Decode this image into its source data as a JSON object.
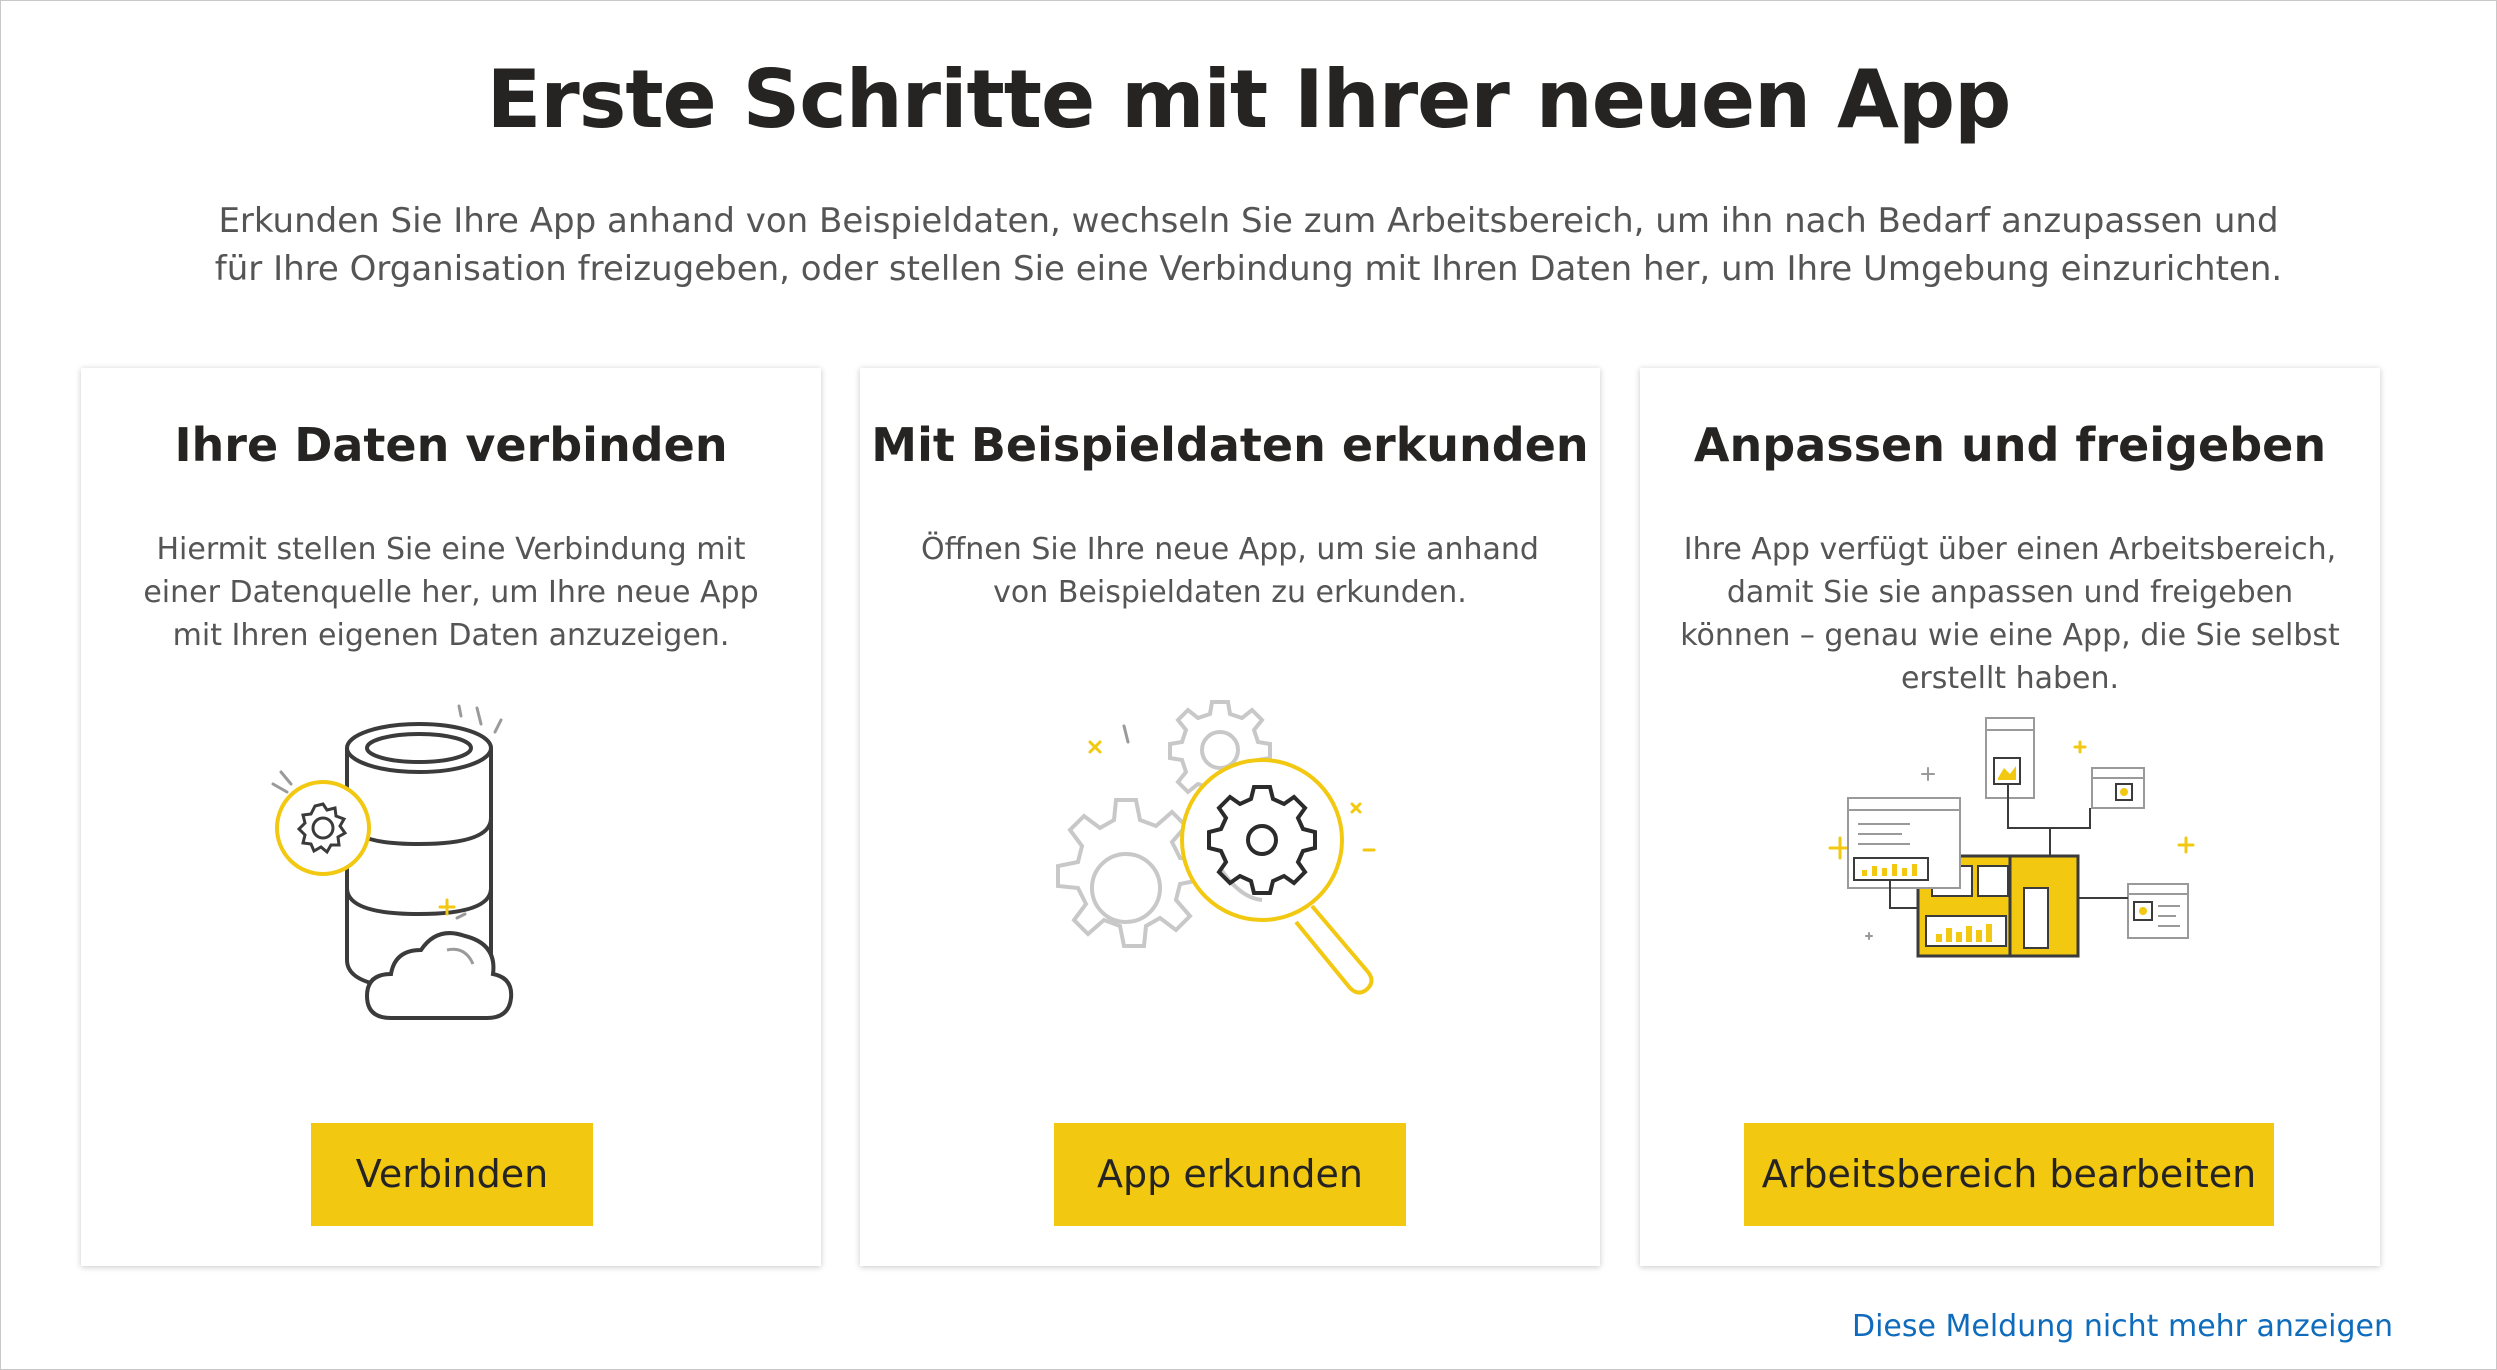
{
  "header": {
    "title": "Erste Schritte mit Ihrer neuen App",
    "subtitle": "Erkunden Sie Ihre App anhand von Beispieldaten, wechseln Sie zum Arbeitsbereich, um ihn nach Bedarf anzupassen und für Ihre Organisation freizugeben, oder stellen Sie eine Verbindung mit Ihren Daten her, um Ihre Umgebung einzurichten."
  },
  "cards": [
    {
      "title": "Ihre Daten verbinden",
      "description": "Hiermit stellen Sie eine Verbindung mit einer Datenquelle her, um Ihre neue App mit Ihren eigenen Daten anzuzeigen.",
      "button_label": "Verbinden",
      "illustration": "database-cloud-icon"
    },
    {
      "title": "Mit Beispieldaten erkunden",
      "description": "Öffnen Sie Ihre neue App, um sie anhand von Beispieldaten zu erkunden.",
      "button_label": "App erkunden",
      "illustration": "gears-magnifier-icon"
    },
    {
      "title": "Anpassen und freigeben",
      "description": "Ihre App verfügt über einen Arbeitsbereich, damit Sie sie anpassen und freigeben können – genau wie eine App, die Sie selbst erstellt haben.",
      "button_label": "Arbeitsbereich bearbeiten",
      "illustration": "workspace-dashboard-icon"
    }
  ],
  "footer": {
    "dismiss_link": "Diese Meldung nicht mehr anzeigen"
  },
  "colors": {
    "accent": "#f2c811",
    "link": "#0f6cbd",
    "text_dark": "#252423",
    "text_muted": "#555555"
  }
}
